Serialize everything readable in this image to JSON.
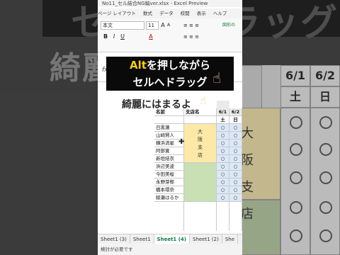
{
  "window": {
    "title": "No11_セル結合NG編ver.xlsx - Excel Preview"
  },
  "ribbon": {
    "tabs": [
      "ページ レイアウト",
      "数式",
      "データ",
      "校閲",
      "表示",
      "ヘルプ"
    ],
    "active_tab": "表示",
    "font_name": "本文",
    "font_size": "11",
    "bold": "B",
    "italic": "I",
    "underline": "U",
    "grow_font": "A",
    "shrink_font": "A",
    "font_color": "A",
    "cond_format": "図形の"
  },
  "formula_bar": {
    "fx": "fx"
  },
  "overlay": {
    "line1_highlight": "Alt",
    "line1_rest": "を押しながら",
    "line2": "セルへドラッグ",
    "subtitle": "綺麗にはまるよ"
  },
  "background": {
    "top_text": "セルへドラッグ",
    "left_text": "綺麗",
    "date1": "6/1",
    "date2": "6/2",
    "day1": "土",
    "day2": "日",
    "side_chars": [
      "大",
      "阪",
      "支",
      "店"
    ]
  },
  "sheet": {
    "headers": [
      "名前",
      "支店名",
      "6/1",
      "6/2"
    ],
    "days": [
      "土",
      "日"
    ],
    "names": [
      "日黒蓮",
      "山崎賢人",
      "横浜流星",
      "阿部寛",
      "新垣結衣",
      "浜辺美波",
      "今田美桜",
      "永野芽郁",
      "橋本環奈",
      "綾瀬はるか"
    ],
    "branch_yellow": [
      "大",
      "阪",
      "支",
      "店"
    ],
    "mark": "○"
  },
  "sheet_tabs": [
    "Sheet1 (3)",
    "Sheet1",
    "Sheet1 (4)",
    "Sheet1 (2)",
    "She"
  ],
  "active_sheet": "Sheet1 (4)",
  "status_text": "検討が必要です",
  "colors": {
    "accent": "#107c41",
    "yellow_fill": "#fde9a7",
    "green_fill": "#c9dfb4",
    "highlight": "#f4d000"
  }
}
